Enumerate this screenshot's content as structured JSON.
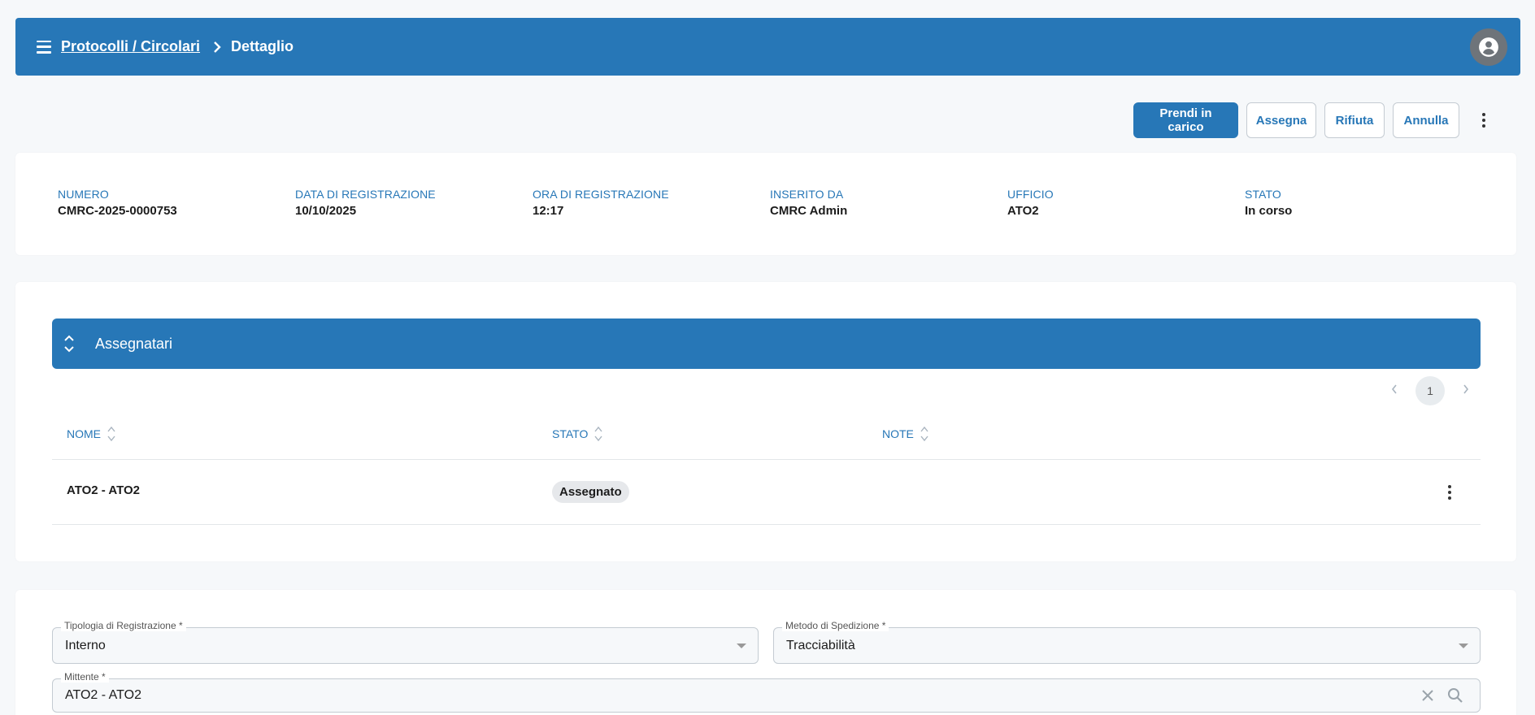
{
  "header": {
    "breadcrumb_parent": "Protocolli / Circolari",
    "breadcrumb_current": "Dettaglio"
  },
  "actions": {
    "take_charge": "Prendi in carico",
    "assign": "Assegna",
    "reject": "Rifiuta",
    "cancel": "Annulla"
  },
  "info": {
    "numero_label": "NUMERO",
    "numero_value": "CMRC-2025-0000753",
    "data_label": "DATA DI REGISTRAZIONE",
    "data_value": "10/10/2025",
    "ora_label": "ORA DI REGISTRAZIONE",
    "ora_value": "12:17",
    "inserito_label": "INSERITO DA",
    "inserito_value": "CMRC Admin",
    "ufficio_label": "UFFICIO",
    "ufficio_value": "ATO2",
    "stato_label": "STATO",
    "stato_value": "In corso"
  },
  "assignees": {
    "title": "Assegnatari",
    "current_page": "1",
    "columns": [
      "NOME",
      "STATO",
      "NOTE"
    ],
    "rows": [
      {
        "nome": "ATO2 - ATO2",
        "stato": "Assegnato",
        "note": ""
      }
    ]
  },
  "form": {
    "tipologia_label": "Tipologia di Registrazione *",
    "tipologia_value": "Interno",
    "metodo_label": "Metodo di Spedizione *",
    "metodo_value": "Tracciabilità",
    "mittente_label": "Mittente *",
    "mittente_value": "ATO2 - ATO2"
  },
  "colors": {
    "primary": "#2777b7",
    "badge_bg": "#e6e8eb"
  },
  "icons": [
    "menu-icon",
    "chevron-right-icon",
    "account-circle-icon",
    "more-vert-icon",
    "unfold-icon",
    "sort-icon",
    "chevron-left-icon",
    "caret-down-icon",
    "close-icon",
    "search-icon"
  ]
}
